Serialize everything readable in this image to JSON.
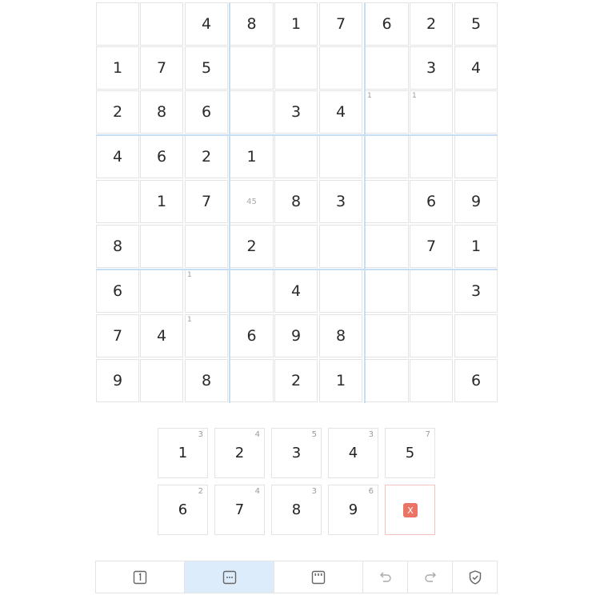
{
  "board": {
    "values": [
      [
        "",
        "",
        "4",
        "8",
        "1",
        "7",
        "6",
        "2",
        "5"
      ],
      [
        "1",
        "7",
        "5",
        "",
        "",
        "",
        "",
        "3",
        "4"
      ],
      [
        "2",
        "8",
        "6",
        "",
        "3",
        "4",
        "",
        "",
        ""
      ],
      [
        "4",
        "6",
        "2",
        "1",
        "",
        "",
        "",
        "",
        ""
      ],
      [
        "",
        "1",
        "7",
        "",
        "8",
        "3",
        "",
        "6",
        "9"
      ],
      [
        "8",
        "",
        "",
        "2",
        "",
        "",
        "",
        "7",
        "1"
      ],
      [
        "6",
        "",
        "",
        "",
        "4",
        "",
        "",
        "",
        "3"
      ],
      [
        "7",
        "4",
        "",
        "6",
        "9",
        "8",
        "",
        "",
        ""
      ],
      [
        "9",
        "",
        "8",
        "",
        "2",
        "1",
        "",
        "",
        "6"
      ]
    ],
    "notes": [
      {
        "row": 2,
        "col": 6,
        "text": "1",
        "style": "corner"
      },
      {
        "row": 2,
        "col": 7,
        "text": "1",
        "style": "corner"
      },
      {
        "row": 4,
        "col": 3,
        "text": "45",
        "style": "center"
      },
      {
        "row": 6,
        "col": 2,
        "text": "1",
        "style": "corner"
      },
      {
        "row": 7,
        "col": 2,
        "text": "1",
        "style": "corner"
      }
    ]
  },
  "numpad": {
    "keys": [
      {
        "digit": "1",
        "count": "3"
      },
      {
        "digit": "2",
        "count": "4"
      },
      {
        "digit": "3",
        "count": "5"
      },
      {
        "digit": "4",
        "count": "3"
      },
      {
        "digit": "5",
        "count": "7"
      },
      {
        "digit": "6",
        "count": "2"
      },
      {
        "digit": "7",
        "count": "4"
      },
      {
        "digit": "8",
        "count": "3"
      },
      {
        "digit": "9",
        "count": "6"
      }
    ],
    "erase_label": "X",
    "erase_color": "#ea7466"
  },
  "toolbar": {
    "tools": [
      {
        "name": "normal-mode",
        "icon": "digit-box-icon",
        "active": false
      },
      {
        "name": "corner-note-mode",
        "icon": "dots-box-icon",
        "active": true
      },
      {
        "name": "center-note-mode",
        "icon": "top-dots-box-icon",
        "active": false
      },
      {
        "name": "undo",
        "icon": "undo-arrow-icon",
        "active": false
      },
      {
        "name": "redo",
        "icon": "redo-arrow-icon",
        "active": false
      },
      {
        "name": "check",
        "icon": "shield-check-icon",
        "active": false
      }
    ],
    "active_color": "#dcecfb"
  },
  "colors": {
    "box_line": "#c5def4",
    "cell_border": "#e3e3e3",
    "digit": "#2a2a2a",
    "note": "#9a9a9a"
  }
}
